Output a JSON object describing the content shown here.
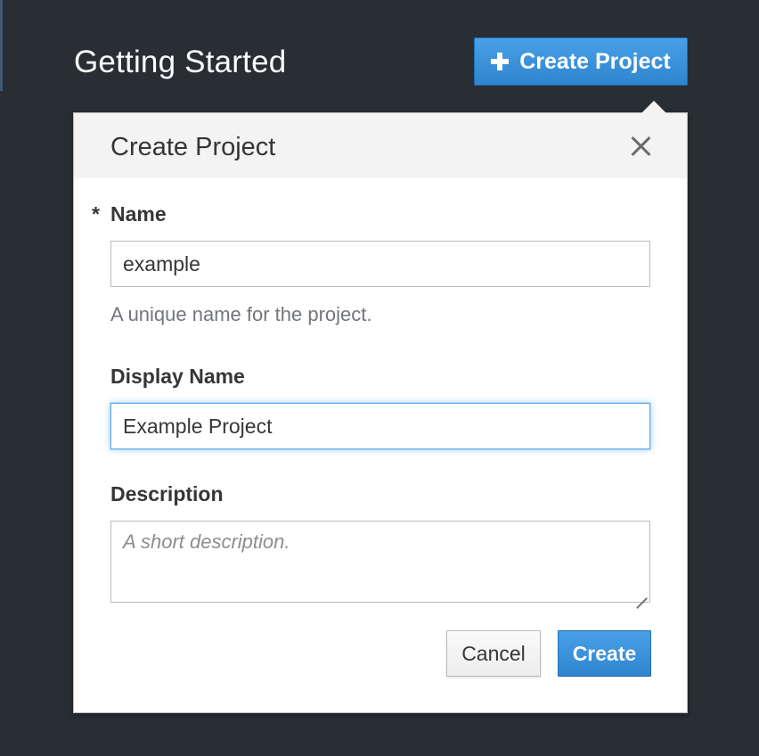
{
  "header": {
    "title": "Getting Started",
    "create_project_label": "Create Project"
  },
  "popover": {
    "title": "Create Project",
    "name_field": {
      "required_mark": "*",
      "label": "Name",
      "value": "example",
      "help": "A unique name for the project."
    },
    "display_name_field": {
      "label": "Display Name",
      "value": "Example Project"
    },
    "description_field": {
      "label": "Description",
      "value": "",
      "placeholder": "A short description."
    },
    "cancel_label": "Cancel",
    "create_label": "Create"
  },
  "icons": {
    "plus": "plus-icon",
    "close": "close-icon"
  },
  "colors": {
    "background": "#292e34",
    "primary_button": "#3a8fd9",
    "focus_ring": "#66afe9"
  }
}
